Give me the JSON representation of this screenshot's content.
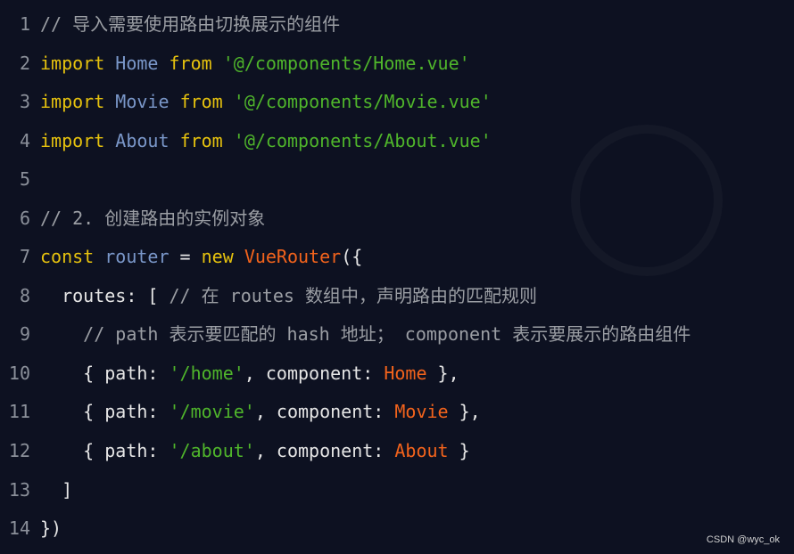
{
  "colors": {
    "background": "#0d1121",
    "comment": "#9b9ea4",
    "keyword": "#e6c20e",
    "identifier": "#7a97c9",
    "string": "#4fb52b",
    "class": "#f2631c",
    "plain": "#e6e6e6"
  },
  "lines": [
    {
      "n": "1",
      "tokens": [
        {
          "t": "// 导入需要使用路由切换展示的组件",
          "c": "comment"
        }
      ]
    },
    {
      "n": "2",
      "tokens": [
        {
          "t": "import",
          "c": "kw"
        },
        {
          "t": " ",
          "c": "plain"
        },
        {
          "t": "Home",
          "c": "id"
        },
        {
          "t": " ",
          "c": "plain"
        },
        {
          "t": "from",
          "c": "kw"
        },
        {
          "t": " ",
          "c": "plain"
        },
        {
          "t": "'@/components/Home.vue'",
          "c": "str"
        }
      ]
    },
    {
      "n": "3",
      "tokens": [
        {
          "t": "import",
          "c": "kw"
        },
        {
          "t": " ",
          "c": "plain"
        },
        {
          "t": "Movie",
          "c": "id"
        },
        {
          "t": " ",
          "c": "plain"
        },
        {
          "t": "from",
          "c": "kw"
        },
        {
          "t": " ",
          "c": "plain"
        },
        {
          "t": "'@/components/Movie.vue'",
          "c": "str"
        }
      ]
    },
    {
      "n": "4",
      "tokens": [
        {
          "t": "import",
          "c": "kw"
        },
        {
          "t": " ",
          "c": "plain"
        },
        {
          "t": "About",
          "c": "id"
        },
        {
          "t": " ",
          "c": "plain"
        },
        {
          "t": "from",
          "c": "kw"
        },
        {
          "t": " ",
          "c": "plain"
        },
        {
          "t": "'@/components/About.vue'",
          "c": "str"
        }
      ]
    },
    {
      "n": "5",
      "tokens": []
    },
    {
      "n": "6",
      "tokens": [
        {
          "t": "// 2. 创建路由的实例对象",
          "c": "comment"
        }
      ]
    },
    {
      "n": "7",
      "tokens": [
        {
          "t": "const",
          "c": "kw"
        },
        {
          "t": " ",
          "c": "plain"
        },
        {
          "t": "router",
          "c": "id"
        },
        {
          "t": " = ",
          "c": "plain"
        },
        {
          "t": "new",
          "c": "kw"
        },
        {
          "t": " ",
          "c": "plain"
        },
        {
          "t": "VueRouter",
          "c": "cls"
        },
        {
          "t": "({",
          "c": "plain"
        }
      ]
    },
    {
      "n": "8",
      "tokens": [
        {
          "t": "  routes: [ ",
          "c": "plain"
        },
        {
          "t": "// 在 routes 数组中，声明路由的匹配规则",
          "c": "comment"
        }
      ]
    },
    {
      "n": "9",
      "tokens": [
        {
          "t": "    // path 表示要匹配的 hash 地址； component 表示要展示的路由组件",
          "c": "comment"
        }
      ]
    },
    {
      "n": "10",
      "tokens": [
        {
          "t": "    { path: ",
          "c": "plain"
        },
        {
          "t": "'/home'",
          "c": "str"
        },
        {
          "t": ", component: ",
          "c": "plain"
        },
        {
          "t": "Home",
          "c": "cls"
        },
        {
          "t": " },",
          "c": "plain"
        }
      ]
    },
    {
      "n": "11",
      "tokens": [
        {
          "t": "    { path: ",
          "c": "plain"
        },
        {
          "t": "'/movie'",
          "c": "str"
        },
        {
          "t": ", component: ",
          "c": "plain"
        },
        {
          "t": "Movie",
          "c": "cls"
        },
        {
          "t": " },",
          "c": "plain"
        }
      ]
    },
    {
      "n": "12",
      "tokens": [
        {
          "t": "    { path: ",
          "c": "plain"
        },
        {
          "t": "'/about'",
          "c": "str"
        },
        {
          "t": ", component: ",
          "c": "plain"
        },
        {
          "t": "About",
          "c": "cls"
        },
        {
          "t": " }",
          "c": "plain"
        }
      ]
    },
    {
      "n": "13",
      "tokens": [
        {
          "t": "  ]",
          "c": "plain"
        }
      ]
    },
    {
      "n": "14",
      "tokens": [
        {
          "t": "})",
          "c": "plain"
        }
      ]
    }
  ],
  "footer": "CSDN @wyc_ok"
}
